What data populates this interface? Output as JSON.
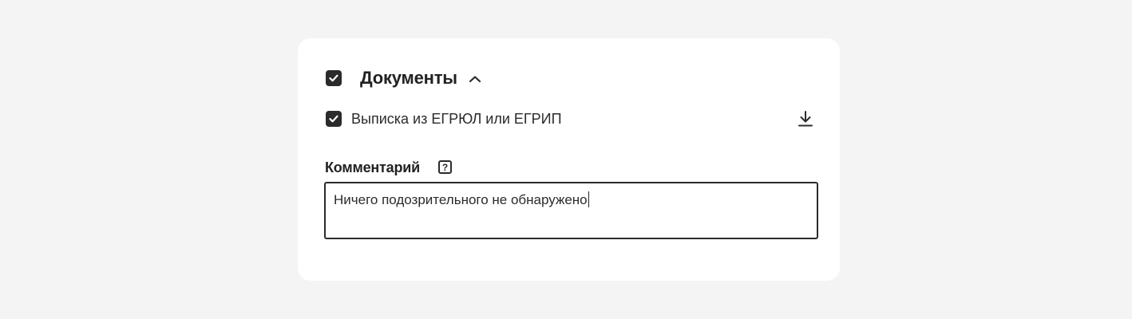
{
  "section": {
    "title": "Документы",
    "checked": true,
    "expanded": true,
    "toggle_icon": "chevron-up-icon"
  },
  "documents": [
    {
      "label": "Выписка из ЕГРЮЛ или ЕГРИП",
      "checked": true,
      "action_icon": "download-icon"
    }
  ],
  "comment": {
    "label": "Комментарий",
    "help_icon": "question-mark-icon",
    "help_glyph": "?",
    "value": "Ничего подозрительного не обнаружено"
  }
}
